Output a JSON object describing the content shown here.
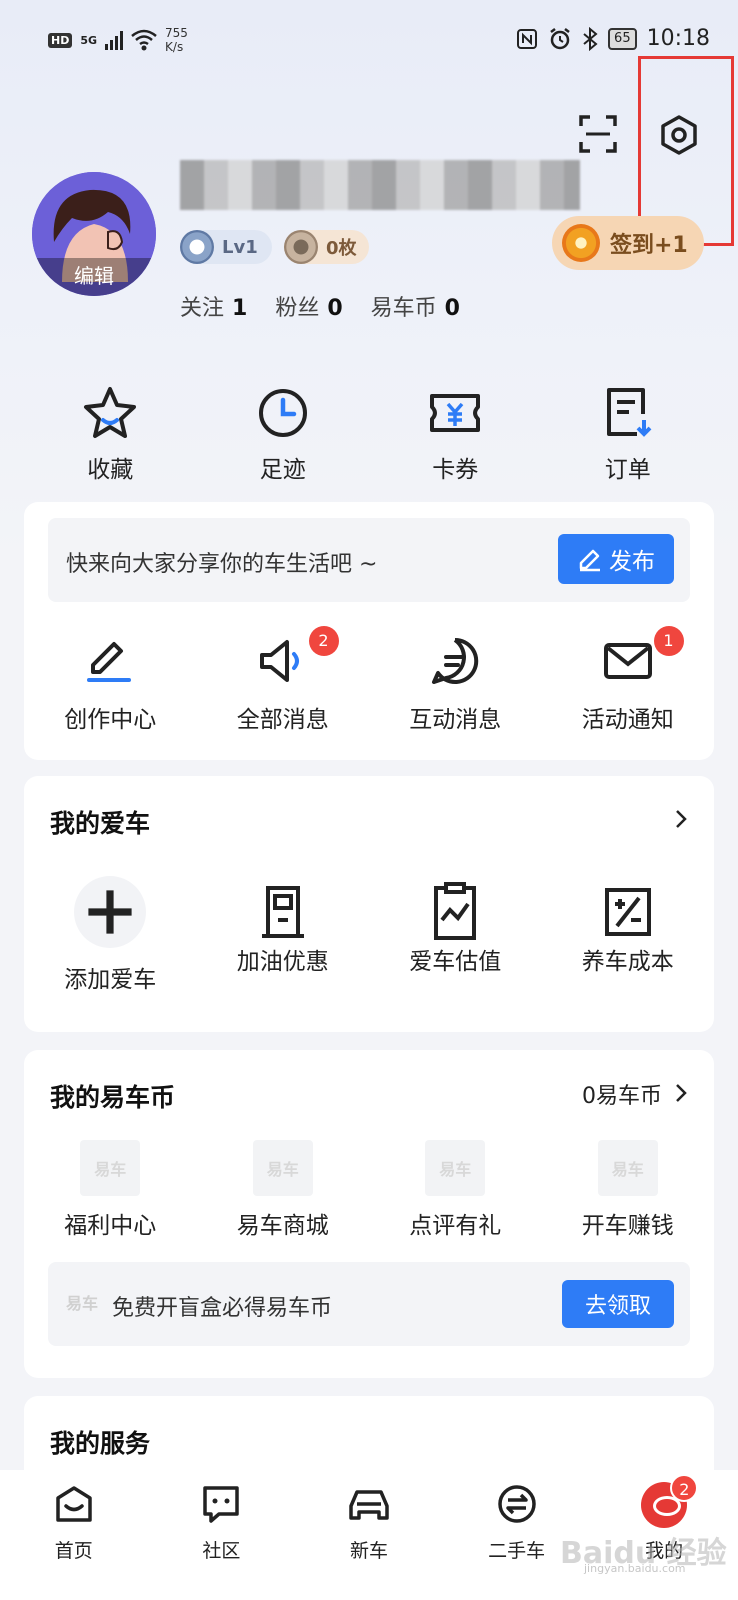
{
  "status_bar": {
    "network": "HD",
    "signal": "5G",
    "speed_value": "755",
    "speed_unit": "K/s",
    "battery": "65",
    "time": "10:18"
  },
  "profile": {
    "avatar_label": "编辑",
    "level": "Lv1",
    "medals": "0枚",
    "checkin_label": "签到+1",
    "stats": [
      {
        "label": "关注",
        "value": "1"
      },
      {
        "label": "粉丝",
        "value": "0"
      },
      {
        "label": "易车币",
        "value": "0"
      }
    ]
  },
  "quick_actions": [
    {
      "label": "收藏",
      "icon": "star-icon"
    },
    {
      "label": "足迹",
      "icon": "clock-icon"
    },
    {
      "label": "卡券",
      "icon": "ticket-icon"
    },
    {
      "label": "订单",
      "icon": "order-icon"
    }
  ],
  "share_card": {
    "prompt": "快来向大家分享你的车生活吧 ~",
    "publish_label": "发布",
    "items": [
      {
        "label": "创作中心",
        "icon": "pen-icon",
        "badge": ""
      },
      {
        "label": "全部消息",
        "icon": "speaker-icon",
        "badge": "2"
      },
      {
        "label": "互动消息",
        "icon": "chat-icon",
        "badge": ""
      },
      {
        "label": "活动通知",
        "icon": "mail-icon",
        "badge": "1"
      }
    ]
  },
  "my_car": {
    "title": "我的爱车",
    "items": [
      {
        "label": "添加爱车",
        "icon": "plus-icon"
      },
      {
        "label": "加油优惠",
        "icon": "fuel-icon"
      },
      {
        "label": "爱车估值",
        "icon": "valuation-icon"
      },
      {
        "label": "养车成本",
        "icon": "cost-icon"
      }
    ]
  },
  "my_coins": {
    "title": "我的易车币",
    "balance": "0易车币",
    "items": [
      {
        "label": "福利中心"
      },
      {
        "label": "易车商城"
      },
      {
        "label": "点评有礼"
      },
      {
        "label": "开车赚钱"
      }
    ],
    "logo_text": "易车",
    "promo_text": "免费开盲盒必得易车币",
    "promo_button": "去领取"
  },
  "my_services": {
    "title": "我的服务"
  },
  "bottom_nav": [
    {
      "label": "首页",
      "icon": "home-icon"
    },
    {
      "label": "社区",
      "icon": "community-icon"
    },
    {
      "label": "新车",
      "icon": "car-icon"
    },
    {
      "label": "二手车",
      "icon": "exchange-icon"
    },
    {
      "label": "我的",
      "icon": "me-avatar-icon",
      "badge": "2"
    }
  ],
  "watermark": {
    "brand": "Baidu 经验",
    "url": "jingyan.baidu.com"
  },
  "colors": {
    "accent": "#2e7cf6",
    "badge_red": "#f0463e",
    "highlight": "#e53935"
  }
}
